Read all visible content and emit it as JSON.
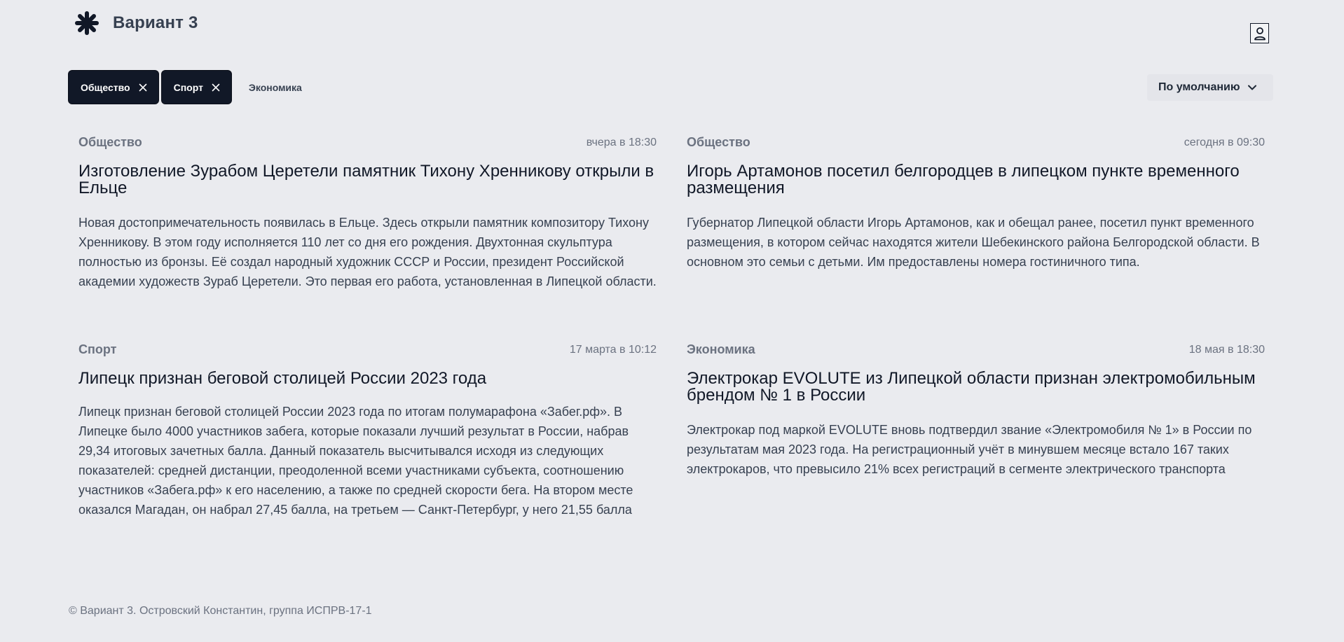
{
  "header": {
    "brand": "Вариант 3",
    "logo_icon": "asterisk-logo-icon",
    "profile_icon": "user-icon"
  },
  "filters": {
    "active": [
      {
        "label": "Общество"
      },
      {
        "label": "Спорт"
      }
    ],
    "inactive": [
      {
        "label": "Экономика"
      }
    ],
    "remove_icon": "close-icon"
  },
  "sort": {
    "label": "По умолчанию",
    "icon": "chevron-down-icon"
  },
  "articles": [
    {
      "category": "Общество",
      "date": "вчера в 18:30",
      "title": "Изготовление Зурабом Церетели памятник Тихону Хренникову открыли в Ельце",
      "body": "Новая достопримечательность появилась в Ельце. Здесь открыли памятник композитору Тихону Хренникову. В этом году исполняется 110 лет со дня его рождения. Двухтонная скульптура полностью из бронзы. Её создал народный художник СССР и России, президент Российской академии художеств Зураб Церетели. Это первая его работа, установленная в Липецкой области."
    },
    {
      "category": "Общество",
      "date": "сегодня в 09:30",
      "title": "Игорь Артамонов посетил белгородцев в липецком пункте временного размещения",
      "body": "Губернатор Липецкой области Игорь Артамонов, как и обещал ранее, посетил пункт временного размещения, в котором сейчас находятся жители Шебекинского района Белгородской области. В основном это семьи с детьми. Им предоставлены номера гостиничного типа."
    },
    {
      "category": "Спорт",
      "date": "17 марта в 10:12",
      "title": "Липецк признан беговой столицей России 2023 года",
      "body": "Липецк признан беговой столицей России 2023 года по итогам полумарафона «Забег.рф». В Липецке было 4000 участников забега, которые показали лучший результат в России, набрав 29,34 итоговых зачетных балла. Данный показатель высчитывался исходя из следующих показателей: средней дистанции, преодоленной всеми участниками субъекта, соотношению участников «Забега.рф» к его населению, а также по средней скорости бега. На втором месте оказался Магадан, он набрал 27,45 балла, на третьем — Санкт-Петербург, у него 21,55 балла"
    },
    {
      "category": "Экономика",
      "date": "18 мая в 18:30",
      "title": "Электрокар EVOLUTE из Липецкой области признан электромобильным брендом № 1 в России",
      "body": "Электрокар под маркой EVOLUTE вновь подтвердил звание «Электромобиля № 1» в России по результатам мая 2023 года. На регистрационный учёт в минувшем месяце встало 167 таких электрокаров, что превысило 21% всех регистраций в сегменте электрического транспорта"
    }
  ],
  "footer": {
    "text": "© Вариант 3. Островский Константин, группа ИСПРВ-17-1"
  }
}
